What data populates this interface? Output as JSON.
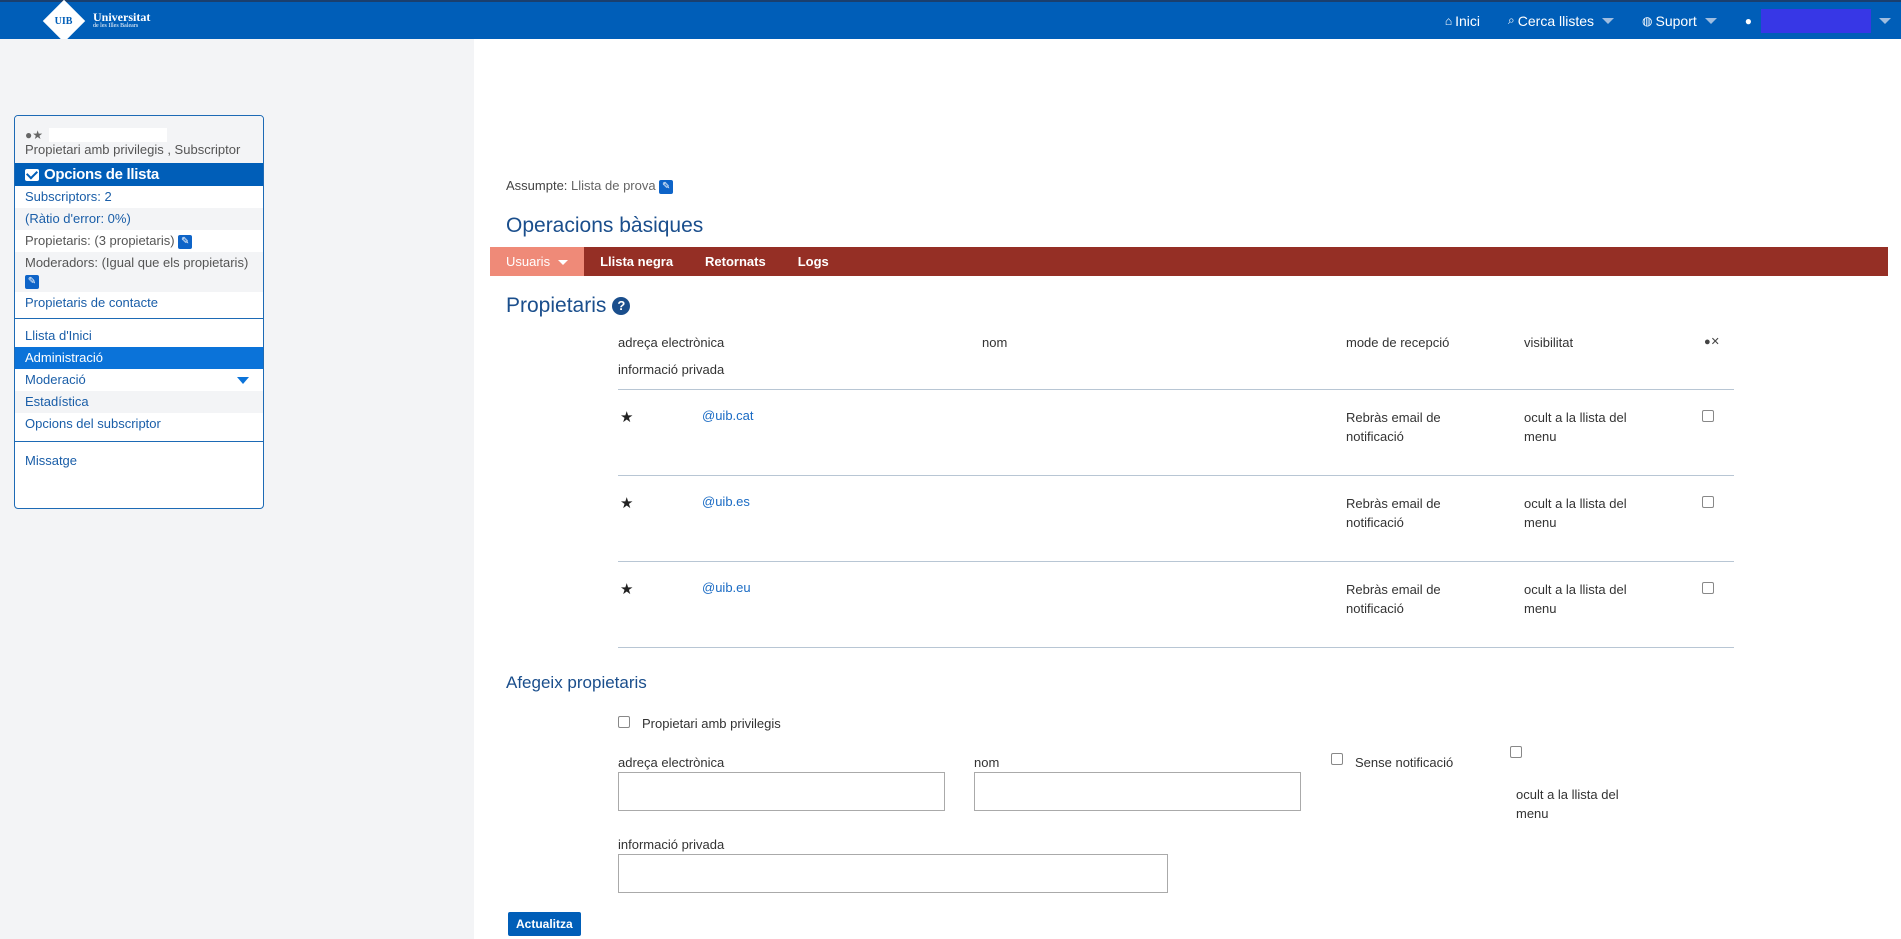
{
  "header": {
    "logo_text": "Universitat",
    "logo_subtext": "de les Illes Balears",
    "logo_mark": "UIB",
    "nav": {
      "home": "Inici",
      "search": "Cerca llistes",
      "support": "Suport"
    },
    "colors": {
      "bar": "#005eb8",
      "user_redacted": "#3737e6"
    }
  },
  "sidebar": {
    "roles": "Propietari amb privilegis , Subscriptor",
    "panel_title": "Opcions de llista",
    "info": [
      "Subscriptors: 2",
      "(Ràtio d'error: 0%)",
      "Propietaris: (3 propietaris)",
      "Moderadors: (Igual que els propietaris)",
      "Propietaris de contacte"
    ],
    "menu": [
      "Llista d'Inici",
      "Administració",
      "Moderació",
      "Estadística",
      "Opcions del subscriptor"
    ],
    "message": "Missatge"
  },
  "main": {
    "subject_label": "Assumpte:",
    "subject_value": "Llista de prova",
    "ops_title": "Operacions bàsiques",
    "tabs": [
      "Usuaris",
      "Llista negra",
      "Retornats",
      "Logs"
    ],
    "owners_title": "Propietaris",
    "help_icon": "?",
    "table": {
      "headers": {
        "email": "adreça electrònica",
        "name": "nom",
        "reception": "mode de recepció",
        "visibility": "visibilitat",
        "private": "informació privada"
      },
      "rows": [
        {
          "email": "@uib.cat",
          "reception": "Rebràs email de notificació",
          "visibility": "ocult a la llista del menu"
        },
        {
          "email": "@uib.es",
          "reception": "Rebràs email de notificació",
          "visibility": "ocult a la llista del menu"
        },
        {
          "email": "@uib.eu",
          "reception": "Rebràs email de notificació",
          "visibility": "ocult a la llista del menu"
        }
      ]
    },
    "add": {
      "title": "Afegeix propietaris",
      "privileged_label": "Propietari amb privilegis",
      "email_label": "adreça electrònica",
      "name_label": "nom",
      "no_notify_label": "Sense notificació",
      "hidden_label": "ocult a la llista del menu",
      "private_label": "informació privada",
      "submit": "Actualitza"
    },
    "colors": {
      "tab_bar": "#952f25",
      "tab_active": "#ef8a78"
    }
  }
}
